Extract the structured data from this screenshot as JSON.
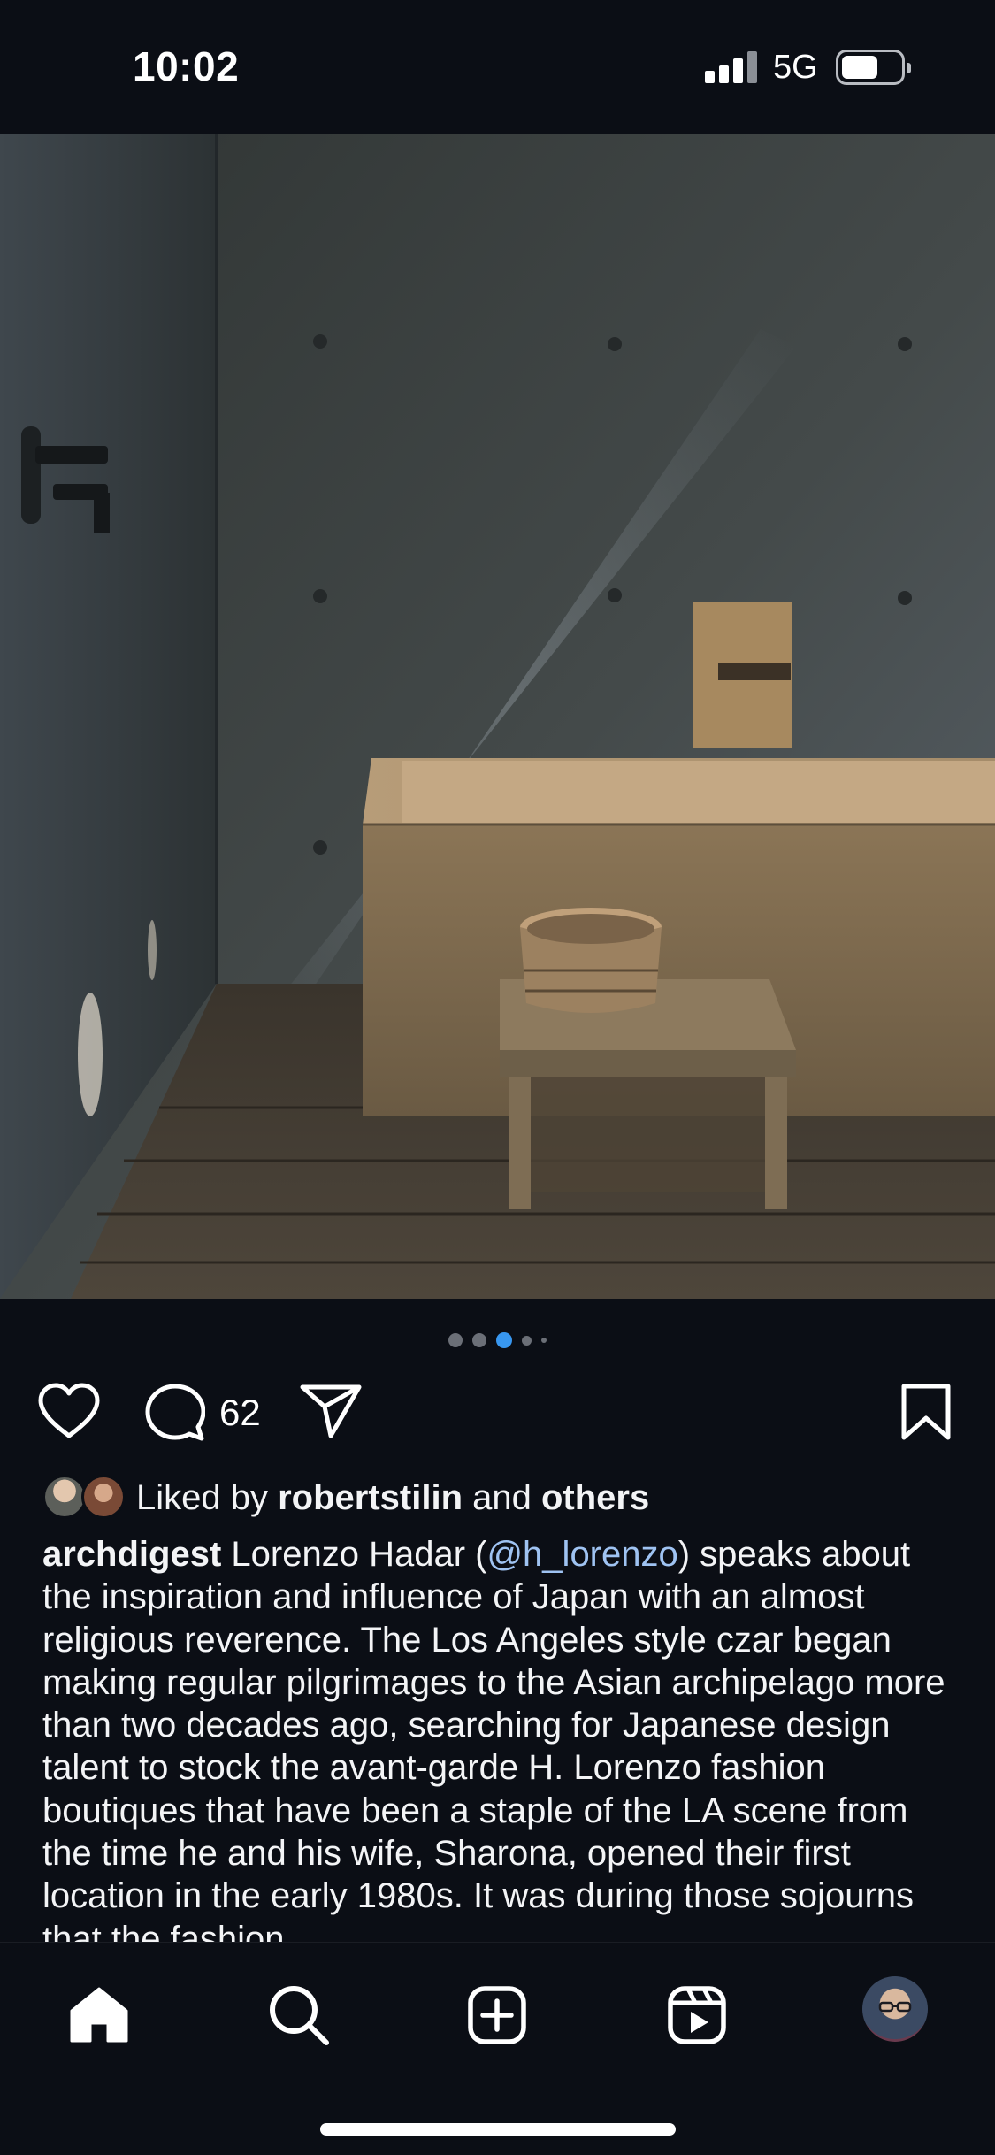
{
  "status_bar": {
    "time": "10:02",
    "network": "5G"
  },
  "post": {
    "carousel": {
      "count": 5,
      "active_index": 2
    },
    "comment_count": "62",
    "likes": {
      "prefix": "Liked by ",
      "user": "robertstilin",
      "middle": " and ",
      "others": "others"
    },
    "caption": {
      "username": "archdigest",
      "text_before_mention": " Lorenzo Hadar (",
      "mention": "@h_lorenzo",
      "text_after_mention": ") speaks about the inspiration and influence of Japan with an almost religious reverence. The Los Angeles style czar began making regular pilgrimages to the Asian archipelago more than two decades ago, searching for Japanese design talent to stock the avant-garde H. Lorenzo fashion boutiques that have been a staple of the LA scene from the time he and his wife, Sharona, opened their first location in the early 1980s. It was during those sojourns that the fashion"
    }
  },
  "tab_bar": {
    "items": [
      "home-icon",
      "search-icon",
      "create-icon",
      "reels-icon",
      "profile-avatar"
    ]
  },
  "colors": {
    "background": "#0b0e15",
    "active_dot": "#3897f0",
    "mention": "#9fc3f2"
  }
}
